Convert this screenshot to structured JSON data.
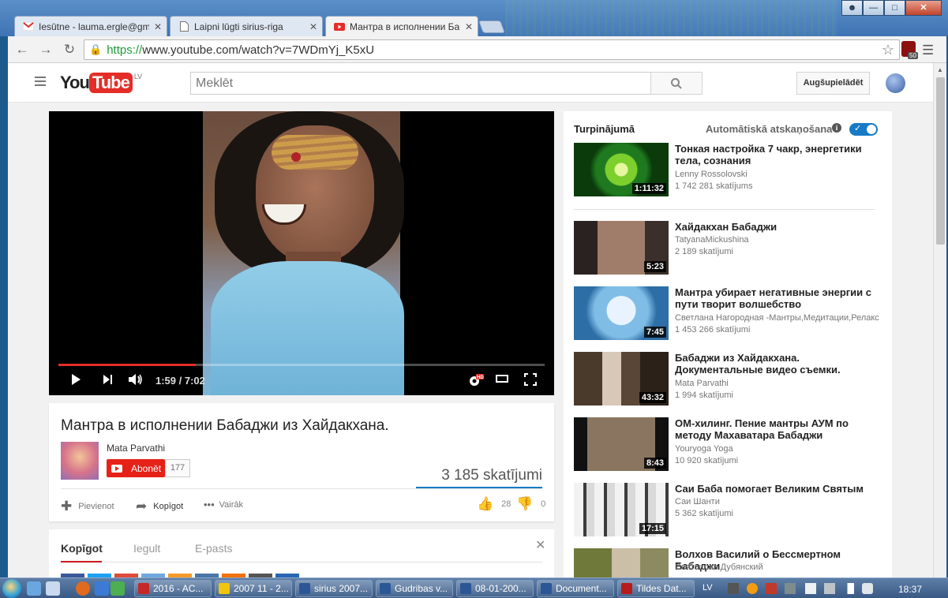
{
  "browser": {
    "tabs": [
      {
        "title": "Iesūtne - lauma.ergle@gm",
        "icon": "gmail-icon"
      },
      {
        "title": "Laipni lūgti sirius-riga",
        "icon": "page-icon"
      },
      {
        "title": "Мантра в исполнении Бабадж",
        "icon": "youtube-icon",
        "active": true
      }
    ],
    "url_scheme": "https://",
    "url_rest": "www.youtube.com/watch?v=7WDmYj_K5xU",
    "ext_badge": "50"
  },
  "youtube": {
    "logo_you": "You",
    "logo_tube": "Tube",
    "country": "LV",
    "search_placeholder": "Meklēt",
    "upload_label": "Augšupielādēt",
    "accent": "#e52d27"
  },
  "player": {
    "time": "1:59 / 7:02",
    "progress_fraction": 0.2826
  },
  "video": {
    "title": "Мантра в исполнении Бабаджи из Хайдакхана.",
    "channel": "Mata Parvathi",
    "subscribe_label": "Abonēt",
    "subscribers": "177",
    "views": "3 185 skatījumi",
    "add_label": "Pievienot",
    "share_label": "Kopīgot",
    "more_label": "Vairāk",
    "likes": "28",
    "dislikes": "0"
  },
  "share": {
    "tabs": [
      "Kopīgot",
      "Iegult",
      "E-pasts"
    ]
  },
  "sidebar": {
    "up_next": "Turpinājumā",
    "autoplay": "Automātiskā atskaņošana",
    "items": [
      {
        "title": "Тонкая настройка 7 чакр, энергетики тела, сознания",
        "author": "Lenny Rossolovski",
        "views": "1 742 281 skatījums",
        "duration": "1:11:32"
      },
      {
        "title": "Хайдакхан Бабаджи",
        "author": "TatyanaMickushina",
        "views": "2 189 skatījumi",
        "duration": "5:23"
      },
      {
        "title": "Мантра убирает негативные энергии с пути творит волшебство",
        "author": "Светлана Нагородная -Мантры,Медитации,Релакс",
        "views": "1 453 266 skatījumi",
        "duration": "7:45"
      },
      {
        "title": "Бабаджи из Хайдакхана. Документальные видео съемки.",
        "author": "Mata Parvathi",
        "views": "1 994 skatījumi",
        "duration": "43:32"
      },
      {
        "title": "ОМ-хилинг. Пение мантры АУМ по методу Махаватара Бабаджи",
        "author": "Youryoga Yoga",
        "views": "10 920 skatījumi",
        "duration": "8:43"
      },
      {
        "title": "Саи Баба помогает Великим Святым",
        "author": "Саи Шанти",
        "views": "5 362 skatījumi",
        "duration": "17:15"
      },
      {
        "title": "Волхов Василий о Бессмертном Бабаджи",
        "author": "Святослав Дубянский",
        "views": "",
        "duration": ""
      }
    ]
  },
  "taskbar": {
    "tasks": [
      "2016 - AC...",
      "2007 11 - 2...",
      "sirius 2007...",
      "Gudribas v...",
      "08-01-200...",
      "Document...",
      "Tildes Dat..."
    ],
    "lang": "LV",
    "clock": "18:37"
  }
}
